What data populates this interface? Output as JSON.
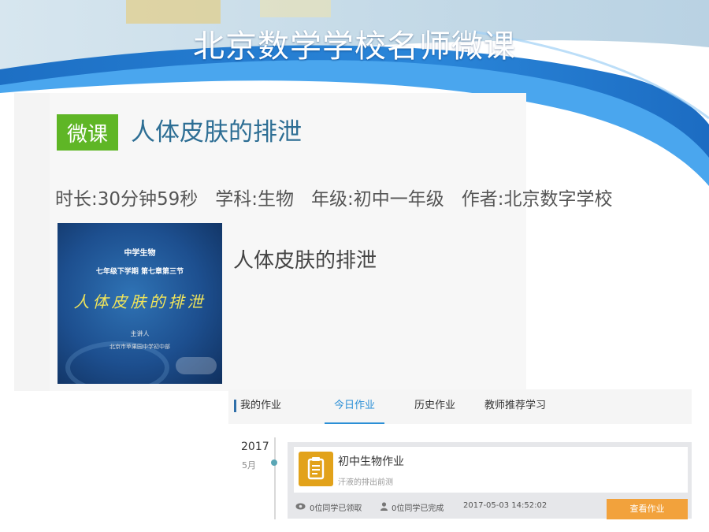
{
  "slide": {
    "title": "北京数学学校名师微课"
  },
  "course": {
    "tag": "微课",
    "title": "人体皮肤的排泄",
    "meta": {
      "duration": "时长:30分钟59秒",
      "subject": "学科:生物",
      "grade": "年级:初中一年级",
      "author": "作者:北京数字学校"
    },
    "thumbnail": {
      "line1": "中学生物",
      "line2": "七年级下学期 第七章第三节",
      "line3": "人体皮肤的排泄",
      "line4": "主讲人 ",
      "line5": "北京市苹果园中学初中部"
    },
    "caption": "人体皮肤的排泄"
  },
  "homework": {
    "tabs": [
      {
        "label": "我的作业"
      },
      {
        "label": "今日作业",
        "active": true
      },
      {
        "label": "历史作业"
      },
      {
        "label": "教师推荐学习"
      }
    ],
    "timeline": {
      "year": "2017",
      "month": "5月"
    },
    "card": {
      "title": "初中生物作业",
      "subtitle": "汗液的排出前测",
      "received": "0位同学已领取",
      "completed": "0位同学已完成",
      "timestamp": "2017-05-03 14:52:02",
      "button": "查看作业"
    }
  },
  "colors": {
    "banner_blue": "#1f7fd6",
    "tag_green": "#5fb626",
    "title_blue": "#2d6e94",
    "active_tab": "#2b8fd6",
    "icon_orange": "#e2a21a",
    "button_orange": "#f2a23c"
  },
  "icons": {
    "homework": "clipboard-icon",
    "received": "eye-icon",
    "completed": "person-icon"
  }
}
